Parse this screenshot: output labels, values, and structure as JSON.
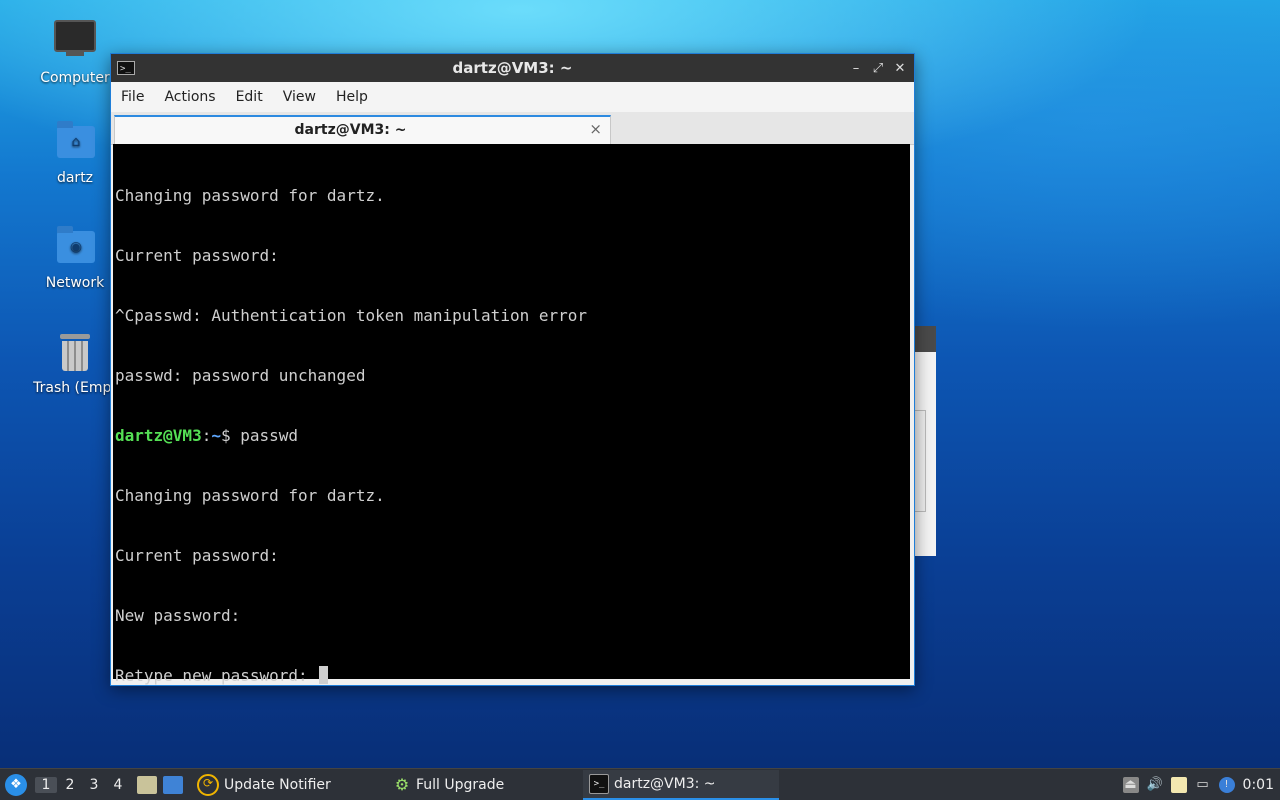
{
  "desktop": {
    "icons": [
      {
        "label": "Computer",
        "icon": "computer-icon"
      },
      {
        "label": "dartz",
        "icon": "home-folder-icon"
      },
      {
        "label": "Network",
        "icon": "network-folder-icon"
      },
      {
        "label": "Trash (Empt",
        "icon": "trash-icon"
      }
    ]
  },
  "window": {
    "title": "dartz@VM3: ~",
    "menu": [
      "File",
      "Actions",
      "Edit",
      "View",
      "Help"
    ],
    "tab_label": "dartz@VM3: ~",
    "tab_close": "×",
    "controls": {
      "minimize": "–",
      "maximize": "⤢",
      "close": "✕"
    }
  },
  "terminal": {
    "lines": [
      "Changing password for dartz.",
      "Current password:",
      "^Cpasswd: Authentication token manipulation error",
      "passwd: password unchanged"
    ],
    "prompt": {
      "user_host": "dartz@VM3",
      "sep": ":",
      "path": "~",
      "symbol": "$",
      "command": " passwd"
    },
    "lines_after": [
      "Changing password for dartz.",
      "Current password:",
      "New password:",
      "Retype new password: "
    ]
  },
  "taskbar": {
    "workspaces": [
      "1",
      "2",
      "3",
      "4"
    ],
    "active_workspace": "1",
    "items": [
      {
        "label": "Update Notifier",
        "icon": "update-notifier-icon",
        "color": "#f0b400"
      },
      {
        "label": "Full Upgrade",
        "icon": "gear-icon",
        "color": "#9be06a"
      },
      {
        "label": "dartz@VM3: ~",
        "icon": "terminal-icon",
        "color": "#dddddd"
      }
    ],
    "clock": "0:01"
  },
  "colors": {
    "accent": "#2a8fe8",
    "prompt_user": "#55e055",
    "prompt_path": "#5fa8ff"
  }
}
